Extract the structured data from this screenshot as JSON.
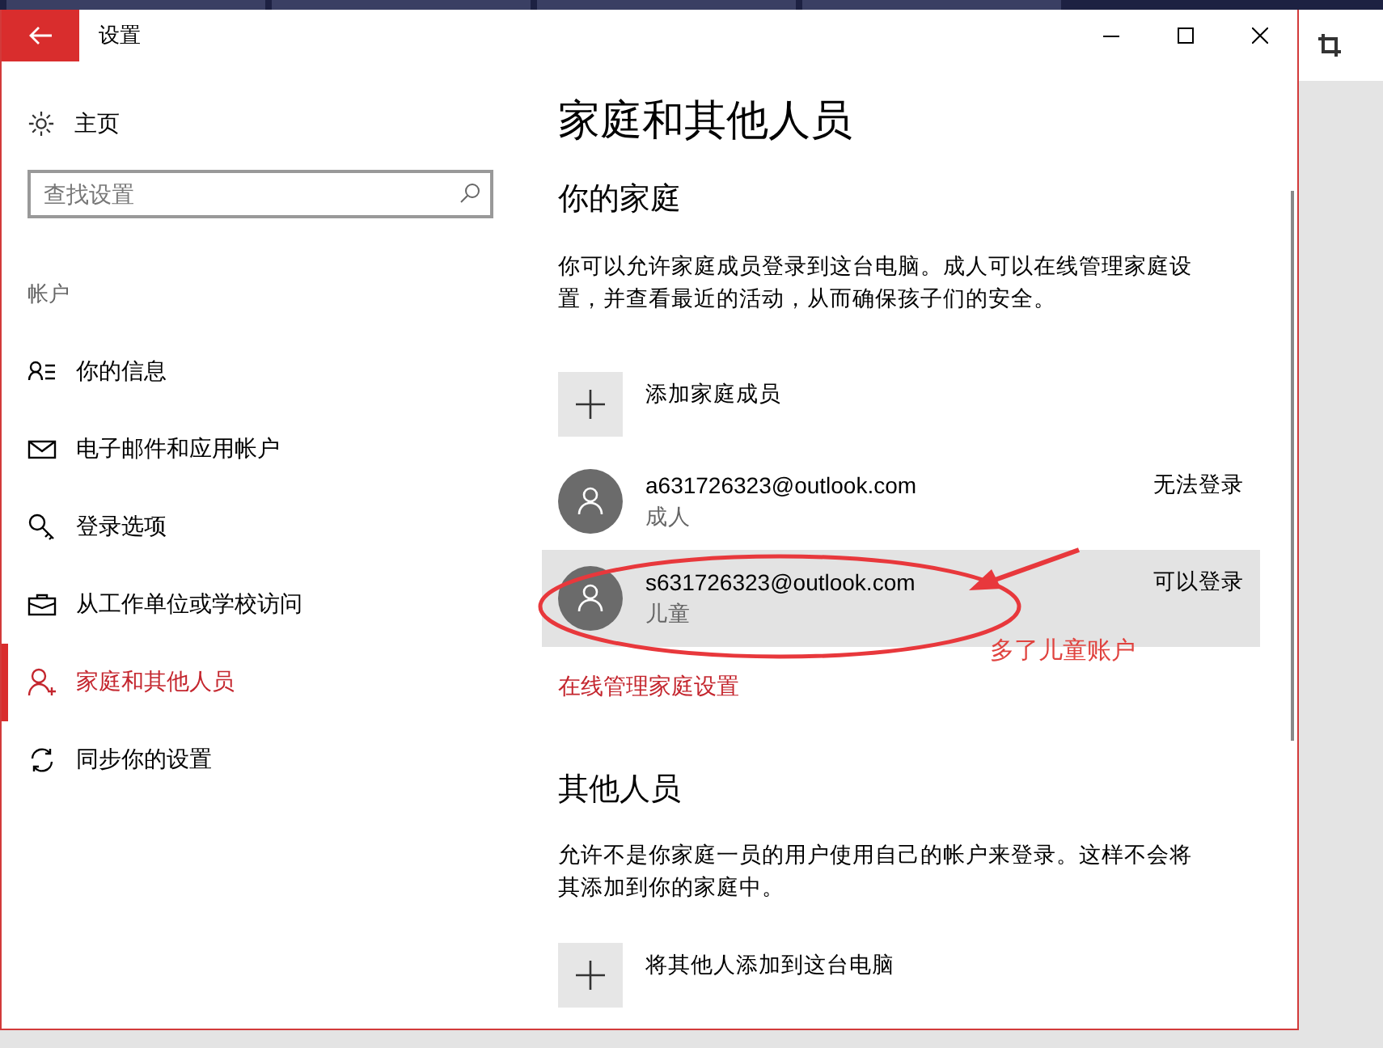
{
  "window": {
    "title": "设置"
  },
  "sidebar": {
    "home": "主页",
    "search": {
      "placeholder": "查找设置"
    },
    "section": "帐户",
    "items": [
      {
        "label": "你的信息",
        "selected": false
      },
      {
        "label": "电子邮件和应用帐户",
        "selected": false
      },
      {
        "label": "登录选项",
        "selected": false
      },
      {
        "label": "从工作单位或学校访问",
        "selected": false
      },
      {
        "label": "家庭和其他人员",
        "selected": true
      },
      {
        "label": "同步你的设置",
        "selected": false
      }
    ]
  },
  "content": {
    "title": "家庭和其他人员",
    "family": {
      "heading": "你的家庭",
      "description": "你可以允许家庭成员登录到这台电脑。成人可以在线管理家庭设置，并查看最近的活动，从而确保孩子们的安全。",
      "add": "添加家庭成员",
      "members": [
        {
          "email": "a631726323@outlook.com",
          "role": "成人",
          "status": "无法登录",
          "selected": false
        },
        {
          "email": "s631726323@outlook.com",
          "role": "儿童",
          "status": "可以登录",
          "selected": true
        }
      ],
      "link": "在线管理家庭设置"
    },
    "others": {
      "heading": "其他人员",
      "description": "允许不是你家庭一员的用户使用自己的帐户来登录。这样不会将其添加到你的家庭中。",
      "add": "将其他人添加到这台电脑"
    }
  },
  "annotation": {
    "text": "多了儿童账户"
  }
}
